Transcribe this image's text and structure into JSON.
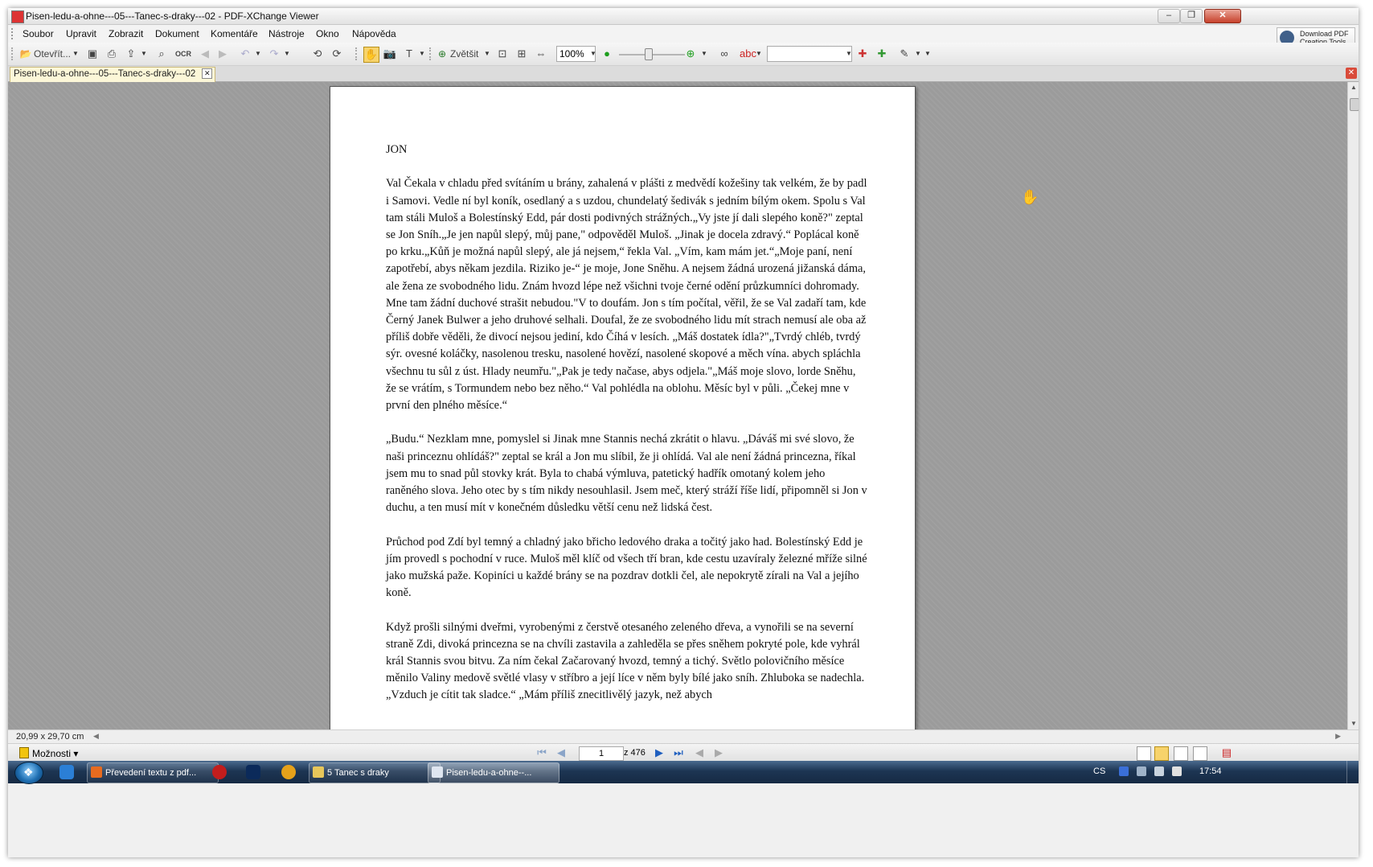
{
  "window": {
    "title": "Pisen-ledu-a-ohne---05---Tanec-s-draky---02 - PDF-XChange Viewer"
  },
  "menu": {
    "items": [
      "Soubor",
      "Upravit",
      "Zobrazit",
      "Dokument",
      "Komentáře",
      "Nástroje",
      "Okno",
      "Nápověda"
    ]
  },
  "promo": {
    "line1": "Download PDF",
    "line2": "Creation Tools"
  },
  "toolbar": {
    "open_label": "Otevřít...",
    "zoom_in_label": "Zvětšit",
    "zoom_value": "100%",
    "search_value": ""
  },
  "tab": {
    "label": "Pisen-ledu-a-ohne---05---Tanec-s-draky---02"
  },
  "document": {
    "heading": "JON",
    "paragraphs": [
      "Val Čekala v chladu před svítáním u brány, zahalená v plášti z medvědí kožešiny tak velkém, že by padl i Samovi. Vedle ní byl koník, osedlaný a s uzdou, chundelatý šedivák s jedním bílým okem. Spolu s Val tam stáli Muloš a Bolestínský Edd, pár dosti podivných strážných.„Vy jste jí dali slepého koně?\" zeptal se Jon Sníh.„Je jen napůl slepý, můj pane,\" odpověděl Muloš. „Jinak je docela zdravý.“ Poplácal koně po krku.„Kůň je možná napůl slepý, ale já nejsem,“ řekla Val. „Vím, kam mám jet.“„Moje paní, není zapotřebí, abys někam jezdila. Riziko je-“ je moje, Jone Sněhu. A nejsem žádná urozená jižanská dáma, ale žena ze svobodného lidu. Znám hvozd lépe než všichni tvoje černé odění průzkumníci dohromady. Mne tam žádní duchové strašit nebudou.\"V to doufám. Jon s tím počítal, věřil, že se Val zadaří tam, kde Černý Janek Bulwer a jeho druhové selhali. Doufal, že ze svobodného lidu mít strach nemusí ale oba až příliš dobře věděli, že divocí nejsou jediní, kdo Číhá v lesích. „Máš dostatek ídla?\"„Tvrdý chléb, tvrdý sýr. ovesné koláčky, nasolenou tresku, nasolené hovězí, nasolené skopové a měch vína. abych spláchla všechnu tu sůl z úst. Hlady neumřu.\"„Pak je tedy načase, abys odjela.\"„Máš moje slovo, lorde Sněhu, že se vrátím, s Tormundem nebo bez něho.“ Val pohlédla na oblohu. Měsíc byl v půli. „Čekej mne v první den plného měsíce.“",
      "„Budu.“ Nezklam mne, pomyslel si Jinak mne Stannis nechá zkrátit o hlavu. „Dáváš mi své slovo, že naši princeznu ohlídáš?\" zeptal se král a Jon mu slíbil, že ji ohlídá. Val ale není žádná princezna, říkal jsem mu to snad půl stovky krát. Byla to chabá výmluva, patetický hadřík omotaný kolem jeho raněného slova. Jeho otec by s tím nikdy nesouhlasil. Jsem meč, který stráží říše lidí, připomněl si Jon v duchu, a ten musí mít v konečném důsledku větší cenu než lidská čest.",
      "Průchod pod Zdí byl temný a chladný jako břicho ledového draka a točitý jako had. Bolestínský Edd je jím provedl s pochodní v ruce. Muloš měl klíč od všech tří bran, kde cestu uzavíraly železné mříže silné jako mužská paže. Kopiníci u každé brány se na pozdrav dotkli čel, ale nepokrytě zírali na Val a jejího koně.",
      "Když prošli silnými dveřmi, vyrobenými z čerstvě otesaného zeleného dřeva, a vynořili se na severní straně Zdi, divoká princezna se na chvíli zastavila a zahleděla se přes sněhem pokryté pole, kde vyhrál král Stannis svou bitvu. Za ním čekal Začarovaný hvozd, temný a tichý. Světlo polovičního měsíce měnilo Valiny medově světlé vlasy v stříbro a její líce v něm byly bílé jako sníh. Zhluboka se nadechla. „Vzduch je cítit tak sladce.“ „Mám příliš znecitlivělý jazyk, než abych"
    ]
  },
  "status": {
    "page_size": "20,99 x 29,70 cm"
  },
  "navigation": {
    "options_label": "Možnosti",
    "current_page": "1",
    "total_pages": "z 476"
  },
  "taskbar": {
    "tasks": [
      {
        "label": "Převedení textu z pdf...",
        "icon": "firefox-icon"
      },
      {
        "label": "5 Tanec s draky",
        "icon": "folder-icon"
      },
      {
        "label": "Pisen-ledu-a-ohne--...",
        "icon": "pdf-icon"
      }
    ],
    "language": "CS",
    "clock": "17:54"
  },
  "colors": {
    "viewer_background": "#9b9b9b",
    "active_tab": "#fcf7d8",
    "taskbar": "#1d3553"
  }
}
